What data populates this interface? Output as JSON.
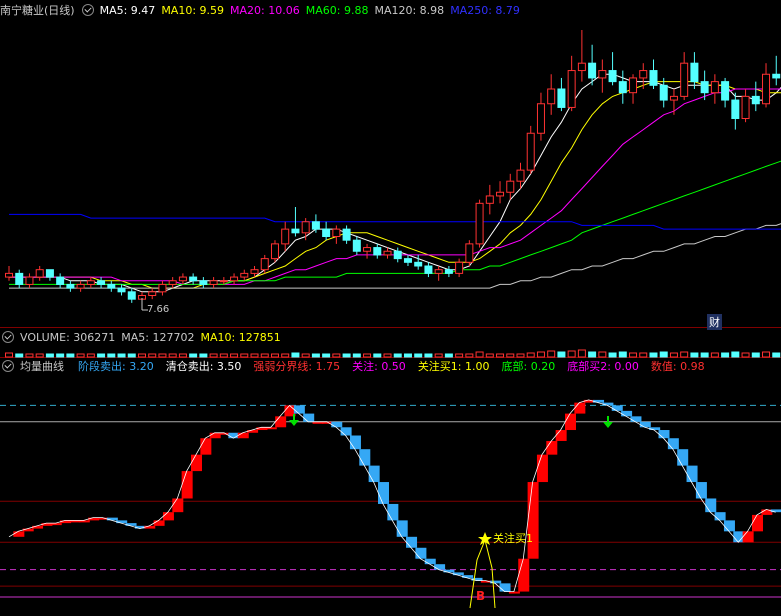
{
  "colors": {
    "background": "#000000",
    "up_candle": "#ff3232",
    "down_candle": "#54ffff",
    "ma5": "#ffffff",
    "ma10": "#ffff00",
    "ma20": "#ff00ff",
    "ma60": "#00ff00",
    "ma120": "#c8c8c8",
    "ma250": "#0000ff",
    "curve_up": "#ff0000",
    "curve_down": "#35a8f5",
    "grid_red": "#800000"
  },
  "price_panel": {
    "title": "南宁糖业(日线)",
    "indicators": [
      {
        "label": "MA5: 9.47",
        "color": "#ffffff"
      },
      {
        "label": "MA10: 9.59",
        "color": "#ffff00"
      },
      {
        "label": "MA20: 10.06",
        "color": "#ff00ff"
      },
      {
        "label": "MA60: 9.88",
        "color": "#00ff00"
      },
      {
        "label": "MA120: 8.98",
        "color": "#c8c8c8"
      },
      {
        "label": "MA250: 8.79",
        "color": "#3030ff"
      }
    ],
    "low_label": "7.66",
    "event_badge": "财"
  },
  "volume_panel": {
    "indicators": [
      {
        "label": "VOLUME: 306271",
        "color": "#c8c8c8"
      },
      {
        "label": "MA5: 127702",
        "color": "#c8c8c8"
      },
      {
        "label": "MA10: 127851",
        "color": "#ffff00"
      }
    ]
  },
  "curve_panel": {
    "title": "均量曲线",
    "indicators": [
      {
        "label": "阶段卖出: ",
        "value": "3.20",
        "lcolor": "#35a8f5",
        "vcolor": "#35a8f5"
      },
      {
        "label": "清仓卖出: ",
        "value": "3.50",
        "lcolor": "#ffffff",
        "vcolor": "#ffffff"
      },
      {
        "label": "强弱分界线: ",
        "value": "1.75",
        "lcolor": "#ff3030",
        "vcolor": "#ff3030"
      },
      {
        "label": "关注: ",
        "value": "0.50",
        "lcolor": "#ff00ff",
        "vcolor": "#ff00ff"
      },
      {
        "label": "关注买1: ",
        "value": "1.00",
        "lcolor": "#ffff00",
        "vcolor": "#ffff00"
      },
      {
        "label": "底部: ",
        "value": "0.20",
        "lcolor": "#00ff00",
        "vcolor": "#00ff00"
      },
      {
        "label": "底部买2: ",
        "value": "0.00",
        "lcolor": "#ff00ff",
        "vcolor": "#ff00ff"
      },
      {
        "label": "数值: ",
        "value": "0.98",
        "lcolor": "#ff3030",
        "vcolor": "#ff3030"
      }
    ],
    "signal_label": "关注买1",
    "buy_mark": "B"
  },
  "chart_data": [
    {
      "type": "candlestick",
      "title": "南宁糖业(日线)",
      "ylim": [
        7.0,
        15.0
      ],
      "candles": [
        [
          8.3,
          8.6,
          8.2,
          8.4
        ],
        [
          8.4,
          8.5,
          8.0,
          8.1
        ],
        [
          8.1,
          8.4,
          8.0,
          8.3
        ],
        [
          8.3,
          8.6,
          8.2,
          8.5
        ],
        [
          8.5,
          8.5,
          8.2,
          8.3
        ],
        [
          8.3,
          8.4,
          8.0,
          8.1
        ],
        [
          8.1,
          8.2,
          7.9,
          8.0
        ],
        [
          8.0,
          8.2,
          7.9,
          8.1
        ],
        [
          8.1,
          8.3,
          8.0,
          8.2
        ],
        [
          8.2,
          8.3,
          8.0,
          8.1
        ],
        [
          8.1,
          8.2,
          7.9,
          8.0
        ],
        [
          8.0,
          8.1,
          7.8,
          7.9
        ],
        [
          7.9,
          8.0,
          7.6,
          7.7
        ],
        [
          7.7,
          7.9,
          7.7,
          7.8
        ],
        [
          7.8,
          8.0,
          7.7,
          7.9
        ],
        [
          7.9,
          8.2,
          7.8,
          8.1
        ],
        [
          8.1,
          8.3,
          8.0,
          8.2
        ],
        [
          8.2,
          8.4,
          8.1,
          8.3
        ],
        [
          8.3,
          8.4,
          8.1,
          8.2
        ],
        [
          8.2,
          8.3,
          8.0,
          8.1
        ],
        [
          8.1,
          8.3,
          8.0,
          8.2
        ],
        [
          8.2,
          8.3,
          8.1,
          8.2
        ],
        [
          8.2,
          8.4,
          8.1,
          8.3
        ],
        [
          8.3,
          8.5,
          8.2,
          8.4
        ],
        [
          8.4,
          8.6,
          8.3,
          8.5
        ],
        [
          8.5,
          8.9,
          8.4,
          8.8
        ],
        [
          8.8,
          9.3,
          8.7,
          9.2
        ],
        [
          9.2,
          9.8,
          9.0,
          9.6
        ],
        [
          9.6,
          10.2,
          9.4,
          9.5
        ],
        [
          9.5,
          9.9,
          9.3,
          9.8
        ],
        [
          9.8,
          10.0,
          9.5,
          9.6
        ],
        [
          9.6,
          9.8,
          9.3,
          9.4
        ],
        [
          9.4,
          9.7,
          9.2,
          9.6
        ],
        [
          9.6,
          9.7,
          9.2,
          9.3
        ],
        [
          9.3,
          9.4,
          8.9,
          9.0
        ],
        [
          9.0,
          9.2,
          8.8,
          9.1
        ],
        [
          9.1,
          9.2,
          8.8,
          8.9
        ],
        [
          8.9,
          9.1,
          8.8,
          9.0
        ],
        [
          9.0,
          9.1,
          8.7,
          8.8
        ],
        [
          8.8,
          8.9,
          8.6,
          8.7
        ],
        [
          8.7,
          8.9,
          8.5,
          8.6
        ],
        [
          8.6,
          8.7,
          8.3,
          8.4
        ],
        [
          8.4,
          8.6,
          8.2,
          8.5
        ],
        [
          8.5,
          8.6,
          8.3,
          8.4
        ],
        [
          8.4,
          8.8,
          8.3,
          8.7
        ],
        [
          8.7,
          9.3,
          8.6,
          9.2
        ],
        [
          9.2,
          10.4,
          9.1,
          10.3
        ],
        [
          10.3,
          10.8,
          10.0,
          10.5
        ],
        [
          10.5,
          10.9,
          10.3,
          10.6
        ],
        [
          10.6,
          11.1,
          10.4,
          10.9
        ],
        [
          10.9,
          11.4,
          10.7,
          11.2
        ],
        [
          11.2,
          12.4,
          11.1,
          12.2
        ],
        [
          12.2,
          13.3,
          12.0,
          13.0
        ],
        [
          13.0,
          13.8,
          12.7,
          13.4
        ],
        [
          13.4,
          13.7,
          12.8,
          12.9
        ],
        [
          12.9,
          14.3,
          12.8,
          13.9
        ],
        [
          13.9,
          15.0,
          13.6,
          14.1
        ],
        [
          14.1,
          14.6,
          13.5,
          13.7
        ],
        [
          13.7,
          14.2,
          13.3,
          13.9
        ],
        [
          13.9,
          14.4,
          13.5,
          13.6
        ],
        [
          13.6,
          13.9,
          13.0,
          13.3
        ],
        [
          13.3,
          13.8,
          13.0,
          13.7
        ],
        [
          13.7,
          14.1,
          13.4,
          13.9
        ],
        [
          13.9,
          14.2,
          13.4,
          13.5
        ],
        [
          13.5,
          13.7,
          12.9,
          13.1
        ],
        [
          13.1,
          13.4,
          12.7,
          13.2
        ],
        [
          13.2,
          14.4,
          13.1,
          14.1
        ],
        [
          14.1,
          14.4,
          13.4,
          13.6
        ],
        [
          13.6,
          13.9,
          13.1,
          13.3
        ],
        [
          13.3,
          13.8,
          13.0,
          13.6
        ],
        [
          13.6,
          13.7,
          12.9,
          13.1
        ],
        [
          13.1,
          13.3,
          12.3,
          12.6
        ],
        [
          12.6,
          13.4,
          12.5,
          13.2
        ],
        [
          13.2,
          13.6,
          12.8,
          13.0
        ],
        [
          13.0,
          14.1,
          12.9,
          13.8
        ],
        [
          13.8,
          14.3,
          13.5,
          13.7
        ],
        [
          13.7,
          13.8,
          13.2,
          13.4
        ],
        [
          13.4,
          13.6,
          13.1,
          13.3
        ]
      ],
      "series": [
        {
          "name": "MA5",
          "values": [
            8.3,
            8.3,
            8.3,
            8.3,
            8.3,
            8.3,
            8.2,
            8.2,
            8.2,
            8.1,
            8.1,
            8.1,
            8.0,
            7.9,
            7.9,
            7.9,
            8.0,
            8.1,
            8.2,
            8.2,
            8.2,
            8.2,
            8.2,
            8.2,
            8.3,
            8.5,
            8.7,
            9.0,
            9.3,
            9.4,
            9.6,
            9.6,
            9.6,
            9.5,
            9.4,
            9.3,
            9.2,
            9.1,
            9.0,
            8.9,
            8.8,
            8.7,
            8.6,
            8.5,
            8.5,
            8.6,
            9.0,
            9.4,
            9.8,
            10.4,
            10.7,
            11.1,
            11.6,
            12.1,
            12.5,
            13.0,
            13.4,
            13.6,
            13.8,
            13.8,
            13.7,
            13.6,
            13.6,
            13.6,
            13.5,
            13.4,
            13.5,
            13.5,
            13.5,
            13.5,
            13.5,
            13.2,
            13.2,
            13.1,
            13.1,
            13.3,
            13.6,
            13.5
          ]
        },
        {
          "name": "MA10",
          "values": [
            8.3,
            8.3,
            8.3,
            8.3,
            8.3,
            8.3,
            8.3,
            8.3,
            8.3,
            8.2,
            8.2,
            8.2,
            8.1,
            8.1,
            8.0,
            8.0,
            8.0,
            8.0,
            8.0,
            8.1,
            8.1,
            8.1,
            8.2,
            8.2,
            8.3,
            8.4,
            8.5,
            8.6,
            8.8,
            9.0,
            9.1,
            9.3,
            9.4,
            9.5,
            9.5,
            9.5,
            9.4,
            9.3,
            9.2,
            9.1,
            9.0,
            8.9,
            8.8,
            8.7,
            8.7,
            8.7,
            8.8,
            9.0,
            9.2,
            9.5,
            9.7,
            10.0,
            10.4,
            10.9,
            11.4,
            11.8,
            12.3,
            12.7,
            13.0,
            13.2,
            13.3,
            13.4,
            13.5,
            13.6,
            13.6,
            13.6,
            13.6,
            13.6,
            13.5,
            13.5,
            13.5,
            13.4,
            13.4,
            13.4,
            13.3,
            13.3,
            13.3,
            13.3
          ]
        },
        {
          "name": "MA20",
          "values": [
            8.3,
            8.3,
            8.3,
            8.3,
            8.3,
            8.3,
            8.3,
            8.3,
            8.3,
            8.3,
            8.3,
            8.2,
            8.2,
            8.2,
            8.2,
            8.2,
            8.2,
            8.1,
            8.1,
            8.1,
            8.1,
            8.1,
            8.1,
            8.1,
            8.2,
            8.2,
            8.3,
            8.4,
            8.5,
            8.5,
            8.6,
            8.7,
            8.8,
            8.8,
            8.9,
            8.9,
            8.9,
            8.9,
            8.9,
            8.9,
            8.9,
            8.9,
            8.9,
            8.9,
            8.9,
            8.9,
            9.0,
            9.1,
            9.1,
            9.2,
            9.3,
            9.5,
            9.7,
            9.9,
            10.1,
            10.4,
            10.7,
            11.0,
            11.3,
            11.6,
            11.9,
            12.1,
            12.3,
            12.5,
            12.7,
            12.8,
            13.0,
            13.1,
            13.2,
            13.3,
            13.3,
            13.4,
            13.4,
            13.4,
            13.4,
            13.4,
            13.4,
            13.4
          ]
        },
        {
          "name": "MA60",
          "values": [
            8.1,
            8.1,
            8.1,
            8.1,
            8.1,
            8.1,
            8.1,
            8.1,
            8.1,
            8.1,
            8.1,
            8.1,
            8.1,
            8.1,
            8.1,
            8.1,
            8.1,
            8.1,
            8.1,
            8.1,
            8.1,
            8.1,
            8.2,
            8.2,
            8.2,
            8.2,
            8.2,
            8.3,
            8.3,
            8.3,
            8.3,
            8.3,
            8.3,
            8.4,
            8.4,
            8.4,
            8.4,
            8.4,
            8.4,
            8.4,
            8.4,
            8.4,
            8.4,
            8.4,
            8.5,
            8.5,
            8.5,
            8.6,
            8.6,
            8.7,
            8.8,
            8.9,
            9.0,
            9.1,
            9.2,
            9.3,
            9.5,
            9.6,
            9.7,
            9.8,
            9.9,
            10.0,
            10.1,
            10.2,
            10.3,
            10.4,
            10.5,
            10.6,
            10.7,
            10.8,
            10.9,
            11.0,
            11.1,
            11.2,
            11.3,
            11.4,
            11.5,
            11.6
          ]
        },
        {
          "name": "MA120",
          "values": [
            8.0,
            8.0,
            8.0,
            8.0,
            8.0,
            8.0,
            8.0,
            8.0,
            8.0,
            8.0,
            8.0,
            8.0,
            8.0,
            8.0,
            8.0,
            8.0,
            8.0,
            8.0,
            8.0,
            8.0,
            8.0,
            8.0,
            8.0,
            8.0,
            8.0,
            8.0,
            8.0,
            8.0,
            8.0,
            8.0,
            8.0,
            8.0,
            8.0,
            8.0,
            8.0,
            8.0,
            8.0,
            8.0,
            8.0,
            8.0,
            8.0,
            8.0,
            8.0,
            8.0,
            8.0,
            8.0,
            8.0,
            8.0,
            8.1,
            8.1,
            8.2,
            8.2,
            8.3,
            8.3,
            8.4,
            8.5,
            8.5,
            8.6,
            8.6,
            8.7,
            8.8,
            8.8,
            8.9,
            9.0,
            9.0,
            9.1,
            9.2,
            9.2,
            9.3,
            9.4,
            9.4,
            9.5,
            9.6,
            9.6,
            9.7,
            9.7,
            9.8,
            9.9
          ]
        },
        {
          "name": "MA250",
          "values": [
            10.0,
            10.0,
            10.0,
            10.0,
            10.0,
            10.0,
            10.0,
            10.0,
            9.9,
            9.9,
            9.9,
            9.9,
            9.9,
            9.9,
            9.9,
            9.9,
            9.9,
            9.9,
            9.9,
            9.9,
            9.9,
            9.9,
            9.9,
            9.9,
            9.9,
            9.9,
            9.8,
            9.8,
            9.8,
            9.8,
            9.8,
            9.8,
            9.8,
            9.8,
            9.8,
            9.8,
            9.8,
            9.8,
            9.8,
            9.8,
            9.8,
            9.8,
            9.8,
            9.8,
            9.8,
            9.8,
            9.8,
            9.8,
            9.8,
            9.8,
            9.8,
            9.8,
            9.8,
            9.8,
            9.8,
            9.8,
            9.7,
            9.7,
            9.7,
            9.7,
            9.7,
            9.7,
            9.7,
            9.7,
            9.6,
            9.6,
            9.6,
            9.6,
            9.6,
            9.6,
            9.6,
            9.6,
            9.6,
            9.6,
            9.6,
            9.6,
            9.6,
            9.6
          ]
        }
      ]
    },
    {
      "type": "bar",
      "title": "VOLUME",
      "values": [
        4,
        3,
        3,
        3,
        3,
        3,
        3,
        3,
        3,
        3,
        3,
        3,
        3,
        3,
        3,
        3,
        3,
        3,
        3,
        3,
        3,
        3,
        3,
        3,
        3,
        3,
        3,
        3,
        4,
        3,
        3,
        3,
        3,
        3,
        3,
        3,
        3,
        3,
        3,
        3,
        3,
        3,
        3,
        3,
        3,
        3,
        5,
        3,
        3,
        3,
        3,
        4,
        5,
        6,
        5,
        6,
        7,
        5,
        5,
        4,
        5,
        4,
        4,
        4,
        5,
        4,
        5,
        4,
        4,
        4,
        4,
        5,
        4,
        4,
        5,
        4,
        4,
        5
      ]
    },
    {
      "type": "line",
      "title": "均量曲线",
      "ylim": [
        -0.2,
        4.0
      ],
      "hlines": [
        3.5,
        3.2,
        1.75,
        1.0,
        0.5,
        0.2,
        0.0
      ],
      "values": [
        1.1,
        1.2,
        1.25,
        1.3,
        1.35,
        1.35,
        1.4,
        1.4,
        1.4,
        1.45,
        1.45,
        1.4,
        1.35,
        1.3,
        1.25,
        1.3,
        1.4,
        1.55,
        1.8,
        2.3,
        2.6,
        2.9,
        3.0,
        3.0,
        2.9,
        3.0,
        3.05,
        3.1,
        3.1,
        3.3,
        3.5,
        3.35,
        3.2,
        3.2,
        3.2,
        3.1,
        2.95,
        2.7,
        2.4,
        2.1,
        1.7,
        1.4,
        1.1,
        0.9,
        0.7,
        0.6,
        0.5,
        0.45,
        0.4,
        0.35,
        0.3,
        0.3,
        0.25,
        0.1,
        0.1,
        0.7,
        2.1,
        2.6,
        2.85,
        3.05,
        3.35,
        3.55,
        3.6,
        3.55,
        3.5,
        3.4,
        3.3,
        3.2,
        3.1,
        3.05,
        2.9,
        2.7,
        2.4,
        2.1,
        1.8,
        1.55,
        1.4,
        1.2,
        1.0,
        1.2,
        1.5,
        1.6,
        1.55
      ],
      "signal_text": "关注买1",
      "mark": "B"
    }
  ]
}
